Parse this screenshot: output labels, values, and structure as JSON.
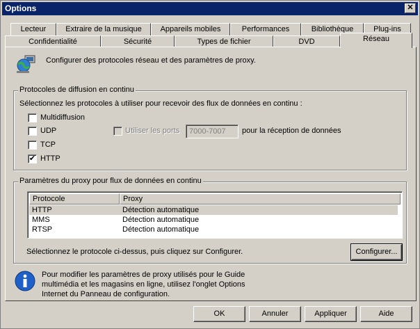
{
  "window": {
    "title": "Options",
    "close_glyph": "✕"
  },
  "tabs_back": [
    "Lecteur",
    "Extraire de la musique",
    "Appareils mobiles",
    "Performances",
    "Bibliothèque",
    "Plug-ins"
  ],
  "tabs_front": [
    "Confidentialité",
    "Sécurité",
    "Types de fichier",
    "DVD",
    "Réseau"
  ],
  "header": {
    "description": "Configurer des protocoles réseau et des paramètres de proxy.",
    "icon": "network-globe-icon"
  },
  "streaming": {
    "title": "Protocoles de diffusion en continu",
    "instruction": "Sélectionnez les protocoles à utiliser pour recevoir des flux de données en continu :",
    "multicast": {
      "label": "Multidiffusion",
      "checked": false
    },
    "udp": {
      "label": "UDP",
      "checked": false
    },
    "tcp": {
      "label": "TCP",
      "checked": false
    },
    "http": {
      "label": "HTTP",
      "checked": true,
      "mark": "✔"
    },
    "ports_label": "Utiliser les ports",
    "ports_value": "7000-7007",
    "ports_suffix": "pour la réception de données"
  },
  "proxy": {
    "title": "Paramètres du proxy pour flux de données en continu",
    "columns": [
      "Protocole",
      "Proxy"
    ],
    "rows": [
      {
        "protocol": "HTTP",
        "proxy": "Détection automatique"
      },
      {
        "protocol": "MMS",
        "proxy": "Détection automatique"
      },
      {
        "protocol": "RTSP",
        "proxy": "Détection automatique"
      }
    ],
    "hint": "Sélectionnez le protocole ci-dessus, puis cliquez sur Configurer.",
    "configure_label": "Configurer..."
  },
  "info": {
    "icon": "info-icon",
    "text_line1": "Pour modifier les paramètres de proxy utilisés pour le Guide",
    "text_line2": "multimédia et les magasins en ligne, utilisez l'onglet Options",
    "text_line3": "Internet du Panneau de configuration."
  },
  "buttons": {
    "ok": "OK",
    "cancel": "Annuler",
    "apply": "Appliquer",
    "help": "Aide"
  }
}
